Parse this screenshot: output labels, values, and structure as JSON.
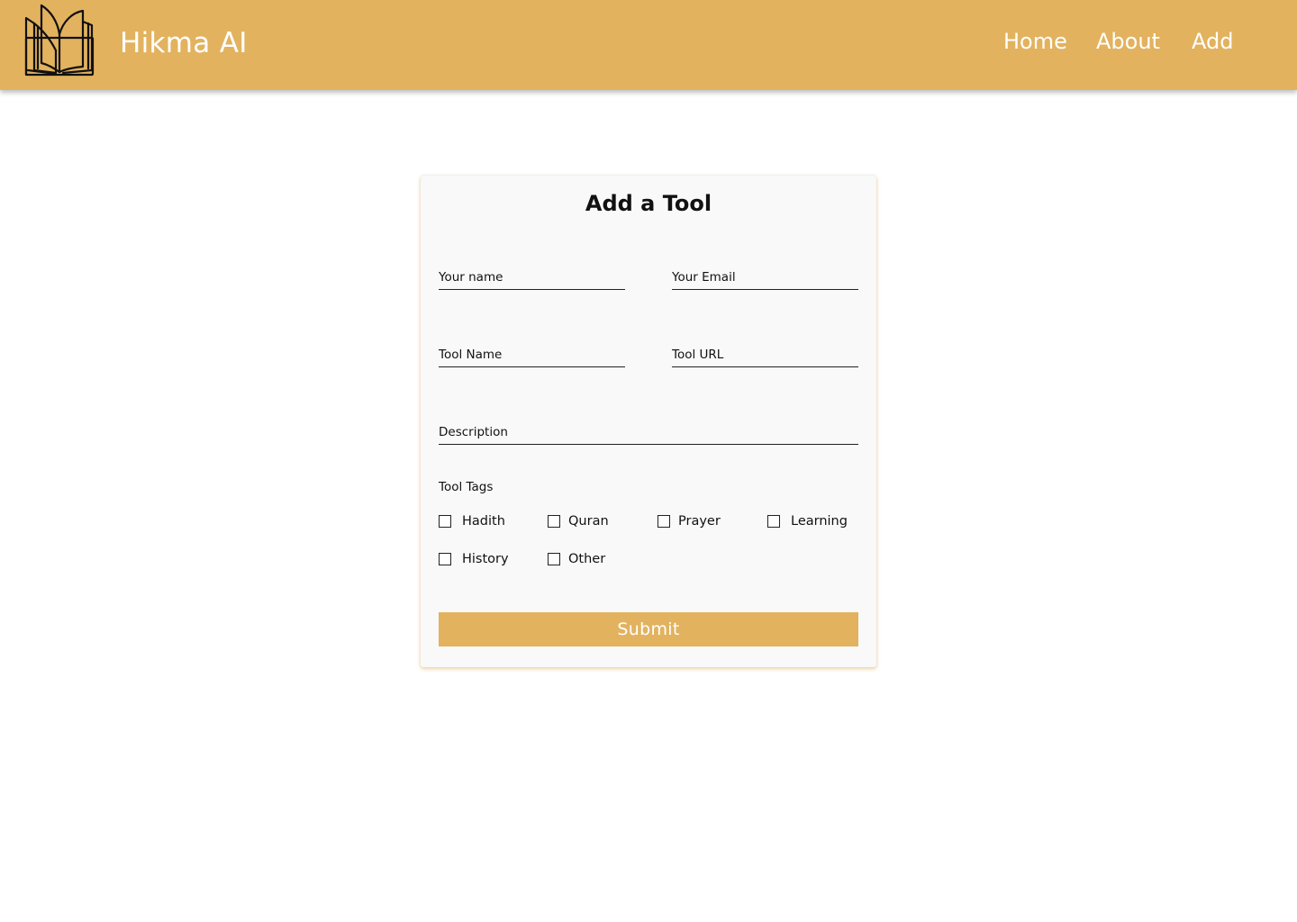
{
  "header": {
    "brand": "Hikma AI",
    "logo_icon": "open-book-icon",
    "background_color": "#e2b25e",
    "nav": [
      {
        "label": "Home"
      },
      {
        "label": "About"
      },
      {
        "label": "Add"
      }
    ]
  },
  "form": {
    "title": "Add a Tool",
    "fields": {
      "name": {
        "placeholder": "Your name",
        "value": ""
      },
      "email": {
        "placeholder": "Your Email",
        "value": ""
      },
      "tool_name": {
        "placeholder": "Tool Name",
        "value": ""
      },
      "tool_url": {
        "placeholder": "Tool URL",
        "value": ""
      },
      "description": {
        "placeholder": "Description",
        "value": ""
      }
    },
    "tags_label": "Tool Tags",
    "tags": [
      {
        "label": "Hadith",
        "checked": false
      },
      {
        "label": "Quran",
        "checked": false
      },
      {
        "label": "Prayer",
        "checked": false
      },
      {
        "label": "Learning",
        "checked": false
      },
      {
        "label": "History",
        "checked": false
      },
      {
        "label": "Other",
        "checked": false
      }
    ],
    "submit_label": "Submit",
    "accent_color": "#e2b25e"
  }
}
